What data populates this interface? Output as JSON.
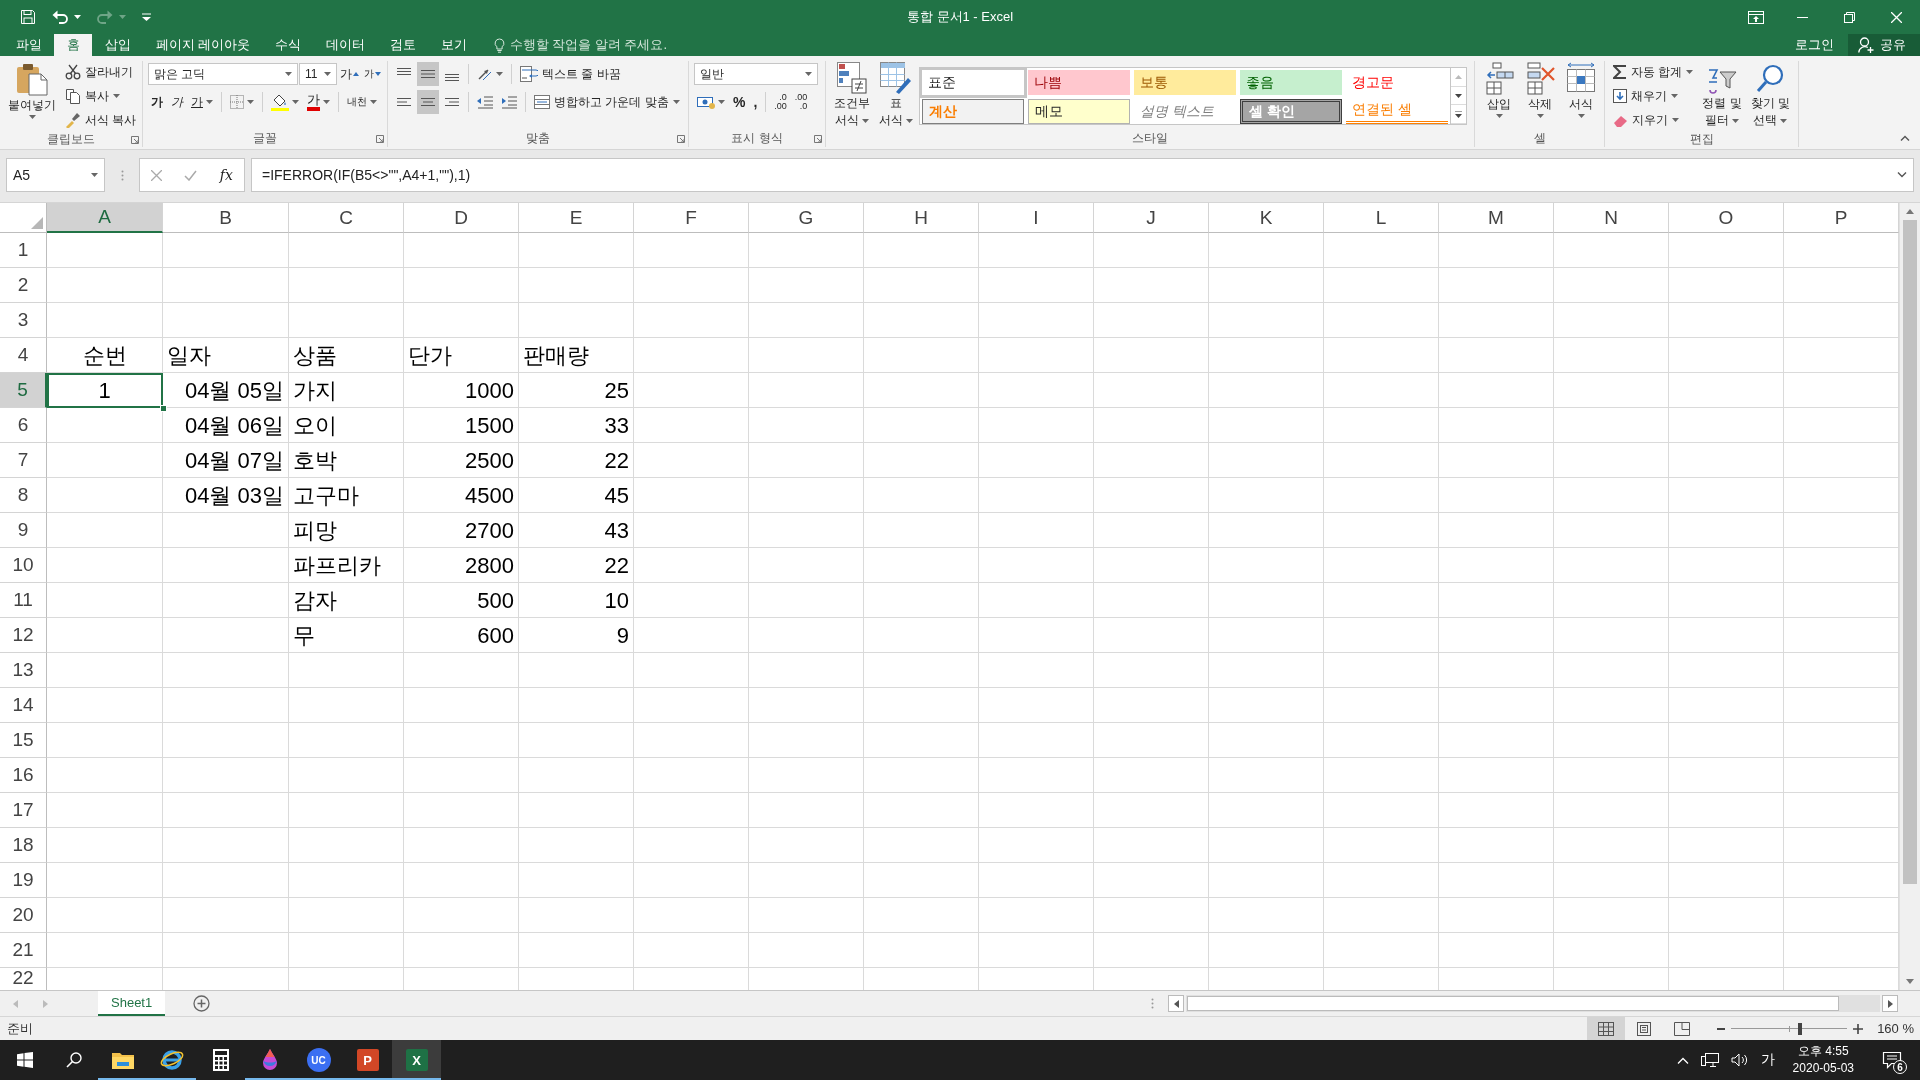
{
  "title_bar": {
    "title": "통합 문서1 - Excel"
  },
  "ribbon_tabs": [
    {
      "label": "파일",
      "selected": false
    },
    {
      "label": "홈",
      "selected": true
    },
    {
      "label": "삽입",
      "selected": false
    },
    {
      "label": "페이지 레이아웃",
      "selected": false
    },
    {
      "label": "수식",
      "selected": false
    },
    {
      "label": "데이터",
      "selected": false
    },
    {
      "label": "검토",
      "selected": false
    },
    {
      "label": "보기",
      "selected": false
    }
  ],
  "tell_me": {
    "placeholder": "수행할 작업을 알려 주세요."
  },
  "account": {
    "sign_in": "로그인",
    "share": "공유"
  },
  "clipboard": {
    "label": "클립보드",
    "paste": "붙여넣기",
    "cut": "잘라내기",
    "copy": "복사",
    "format_painter": "서식 복사"
  },
  "font": {
    "label": "글꼴",
    "font_name": "맑은 고딕",
    "font_size": "11",
    "grow": "가",
    "shrink": "가",
    "bold": "가",
    "italic": "가",
    "underline": "가",
    "font_color": "가",
    "phonetic": "내천"
  },
  "alignment": {
    "label": "맞춤",
    "vertical": [
      {
        "selected": false
      },
      {
        "selected": true
      },
      {
        "selected": false
      }
    ],
    "horizontal": [
      {
        "selected": false
      },
      {
        "selected": true
      },
      {
        "selected": false
      }
    ],
    "wrap_text": "텍스트 줄 바꿈",
    "merge_center": "병합하고 가운데 맞춤"
  },
  "number": {
    "label": "표시 형식",
    "format": "일반",
    "percent": "%",
    "comma": ",",
    "decimals": [
      {
        "top": ".0",
        "bottom": ".00"
      },
      {
        "top": ".00",
        "bottom": ".0"
      }
    ]
  },
  "styles": {
    "label": "스타일",
    "conditional_formatting": [
      "조건부",
      "서식"
    ],
    "format_as_table": [
      "표",
      "서식"
    ],
    "cell_styles": [
      {
        "label": "표준",
        "kind": "normal"
      },
      {
        "label": "나쁨",
        "kind": "bad"
      },
      {
        "label": "보통",
        "kind": "neutral"
      },
      {
        "label": "좋음",
        "kind": "good"
      },
      {
        "label": "경고문",
        "kind": "warning"
      },
      {
        "label": "계산",
        "kind": "calculation"
      },
      {
        "label": "메모",
        "kind": "note"
      },
      {
        "label": "설명 텍스트",
        "kind": "explanatory"
      },
      {
        "label": "셀 확인",
        "kind": "check"
      },
      {
        "label": "연결된 셀",
        "kind": "linked"
      }
    ]
  },
  "cells": {
    "label": "셀",
    "buttons": [
      {
        "label": "삽입",
        "kind": "insert"
      },
      {
        "label": "삭제",
        "kind": "delete"
      },
      {
        "label": "서식",
        "kind": "format"
      }
    ]
  },
  "editing": {
    "label": "편집",
    "autosum": "자동 합계",
    "fill": "채우기",
    "clear": "지우기",
    "sort_filter": [
      "정렬 및",
      "필터"
    ],
    "find_select": [
      "찾기 및",
      "선택"
    ]
  },
  "formula_bar": {
    "name_box": "A5",
    "function_label": "fx",
    "formula": "=IFERROR(IF(B5<>\"\",A4+1,\"\"),1)"
  },
  "sheet": {
    "columns": [
      {
        "label": "A",
        "selected": true
      },
      {
        "label": "B",
        "selected": false
      },
      {
        "label": "C",
        "selected": false
      },
      {
        "label": "D",
        "selected": false
      },
      {
        "label": "E",
        "selected": false
      },
      {
        "label": "F",
        "selected": false
      },
      {
        "label": "G",
        "selected": false
      },
      {
        "label": "H",
        "selected": false
      },
      {
        "label": "I",
        "selected": false
      },
      {
        "label": "J",
        "selected": false
      },
      {
        "label": "K",
        "selected": false
      },
      {
        "label": "L",
        "selected": false
      },
      {
        "label": "M",
        "selected": false
      },
      {
        "label": "N",
        "selected": false
      },
      {
        "label": "O",
        "selected": false
      },
      {
        "label": "P",
        "selected": false
      }
    ],
    "rows": [
      {
        "label": "1",
        "selected": false
      },
      {
        "label": "2",
        "selected": false
      },
      {
        "label": "3",
        "selected": false
      },
      {
        "label": "4",
        "selected": false,
        "cells": {
          "A": {
            "value": "순번",
            "kind": "centered",
            "selected": false
          },
          "B": {
            "value": "일자",
            "kind": "text",
            "selected": false
          },
          "C": {
            "value": "상품",
            "kind": "text",
            "selected": false
          },
          "D": {
            "value": "단가",
            "kind": "text",
            "selected": false
          },
          "E": {
            "value": "판매량",
            "kind": "text",
            "selected": false
          }
        }
      },
      {
        "label": "5",
        "selected": true,
        "cells": {
          "A": {
            "value": "1",
            "kind": "centered",
            "selected": true
          },
          "B": {
            "value": "04월 05일",
            "kind": "number",
            "selected": false
          },
          "C": {
            "value": "가지",
            "kind": "text",
            "selected": false
          },
          "D": {
            "value": "1000",
            "kind": "number",
            "selected": false
          },
          "E": {
            "value": "25",
            "kind": "number",
            "selected": false
          }
        }
      },
      {
        "label": "6",
        "selected": false,
        "cells": {
          "B": {
            "value": "04월 06일",
            "kind": "number",
            "selected": false
          },
          "C": {
            "value": "오이",
            "kind": "text",
            "selected": false
          },
          "D": {
            "value": "1500",
            "kind": "number",
            "selected": false
          },
          "E": {
            "value": "33",
            "kind": "number",
            "selected": false
          }
        }
      },
      {
        "label": "7",
        "selected": false,
        "cells": {
          "B": {
            "value": "04월 07일",
            "kind": "number",
            "selected": false
          },
          "C": {
            "value": "호박",
            "kind": "text",
            "selected": false
          },
          "D": {
            "value": "2500",
            "kind": "number",
            "selected": false
          },
          "E": {
            "value": "22",
            "kind": "number",
            "selected": false
          }
        }
      },
      {
        "label": "8",
        "selected": false,
        "cells": {
          "B": {
            "value": "04월 03일",
            "kind": "number",
            "selected": false
          },
          "C": {
            "value": "고구마",
            "kind": "text",
            "selected": false
          },
          "D": {
            "value": "4500",
            "kind": "number",
            "selected": false
          },
          "E": {
            "value": "45",
            "kind": "number",
            "selected": false
          }
        }
      },
      {
        "label": "9",
        "selected": false,
        "cells": {
          "C": {
            "value": "피망",
            "kind": "text",
            "selected": false
          },
          "D": {
            "value": "2700",
            "kind": "number",
            "selected": false
          },
          "E": {
            "value": "43",
            "kind": "number",
            "selected": false
          }
        }
      },
      {
        "label": "10",
        "selected": false,
        "cells": {
          "C": {
            "value": "파프리카",
            "kind": "text",
            "selected": false
          },
          "D": {
            "value": "2800",
            "kind": "number",
            "selected": false
          },
          "E": {
            "value": "22",
            "kind": "number",
            "selected": false
          }
        }
      },
      {
        "label": "11",
        "selected": false,
        "cells": {
          "C": {
            "value": "감자",
            "kind": "text",
            "selected": false
          },
          "D": {
            "value": "500",
            "kind": "number",
            "selected": false
          },
          "E": {
            "value": "10",
            "kind": "number",
            "selected": false
          }
        }
      },
      {
        "label": "12",
        "selected": false,
        "cells": {
          "C": {
            "value": "무",
            "kind": "text",
            "selected": false
          },
          "D": {
            "value": "600",
            "kind": "number",
            "selected": false
          },
          "E": {
            "value": "9",
            "kind": "number",
            "selected": false
          }
        }
      },
      {
        "label": "13",
        "selected": false
      },
      {
        "label": "14",
        "selected": false
      },
      {
        "label": "15",
        "selected": false
      },
      {
        "label": "16",
        "selected": false
      },
      {
        "label": "17",
        "selected": false
      },
      {
        "label": "18",
        "selected": false
      },
      {
        "label": "19",
        "selected": false
      },
      {
        "label": "20",
        "selected": false
      },
      {
        "label": "21",
        "selected": false
      },
      {
        "label": "22",
        "selected": false
      }
    ]
  },
  "sheet_tabs": [
    {
      "label": "Sheet1",
      "selected": true
    }
  ],
  "status_bar": {
    "status": "준비",
    "views": [
      {
        "kind": "normal",
        "selected": true
      },
      {
        "kind": "page_layout",
        "selected": false
      },
      {
        "kind": "page_break",
        "selected": false
      }
    ],
    "zoom": {
      "level": 0.59,
      "reading": "160 %"
    }
  },
  "taskbar": {
    "apps": [
      {
        "kind": "folder",
        "running": true,
        "selected": false
      },
      {
        "kind": "browser",
        "running": true,
        "selected": false
      },
      {
        "kind": "calculator",
        "running": false,
        "selected": false
      },
      {
        "kind": "paint",
        "running": true,
        "selected": false
      },
      {
        "kind": "chat",
        "label": "UC",
        "running": true,
        "selected": false
      },
      {
        "kind": "presentation",
        "label": "P",
        "running": true,
        "selected": false
      },
      {
        "kind": "spreadsheet",
        "label": "X",
        "running": true,
        "selected": true
      }
    ],
    "input_method": "가",
    "time": "오후 4:55",
    "date": "2020-05-03",
    "notification_count": "6"
  }
}
